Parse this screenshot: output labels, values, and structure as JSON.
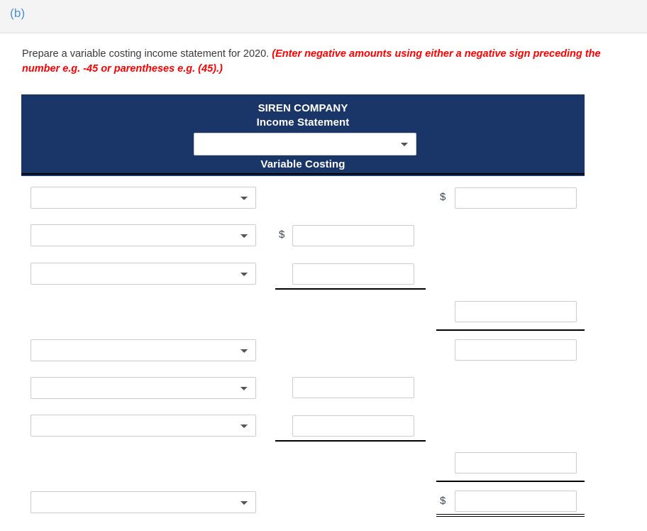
{
  "part": {
    "label": "(b)"
  },
  "instructions": {
    "text": "Prepare a variable costing income statement for 2020. ",
    "hint": "(Enter negative amounts using either a negative sign preceding the number e.g. -45 or parentheses e.g. (45).)"
  },
  "statement": {
    "company": "SIREN COMPANY",
    "title": "Income Statement",
    "basis": "Variable Costing",
    "period_select": {
      "value": "",
      "placeholder": ""
    },
    "currency_symbol": "$",
    "rows": [
      {
        "account": {
          "value": ""
        },
        "right": {
          "value": "",
          "dollar": true
        }
      },
      {
        "account": {
          "value": ""
        },
        "mid": {
          "value": "",
          "dollar": true
        }
      },
      {
        "account": {
          "value": ""
        },
        "mid": {
          "value": "",
          "dollar": false
        }
      },
      {
        "right": {
          "value": "",
          "dollar": false
        }
      },
      {
        "account": {
          "value": ""
        },
        "right": {
          "value": "",
          "dollar": false
        }
      },
      {
        "account": {
          "value": ""
        },
        "mid": {
          "value": "",
          "dollar": false
        }
      },
      {
        "account": {
          "value": ""
        },
        "mid": {
          "value": "",
          "dollar": false
        }
      },
      {
        "right": {
          "value": "",
          "dollar": false
        }
      },
      {
        "account": {
          "value": ""
        },
        "right": {
          "value": "",
          "dollar": true
        }
      }
    ]
  },
  "colors": {
    "header_navy": "#1a3668",
    "part_blue": "#4a90d9",
    "hint_red": "#ff0000"
  }
}
